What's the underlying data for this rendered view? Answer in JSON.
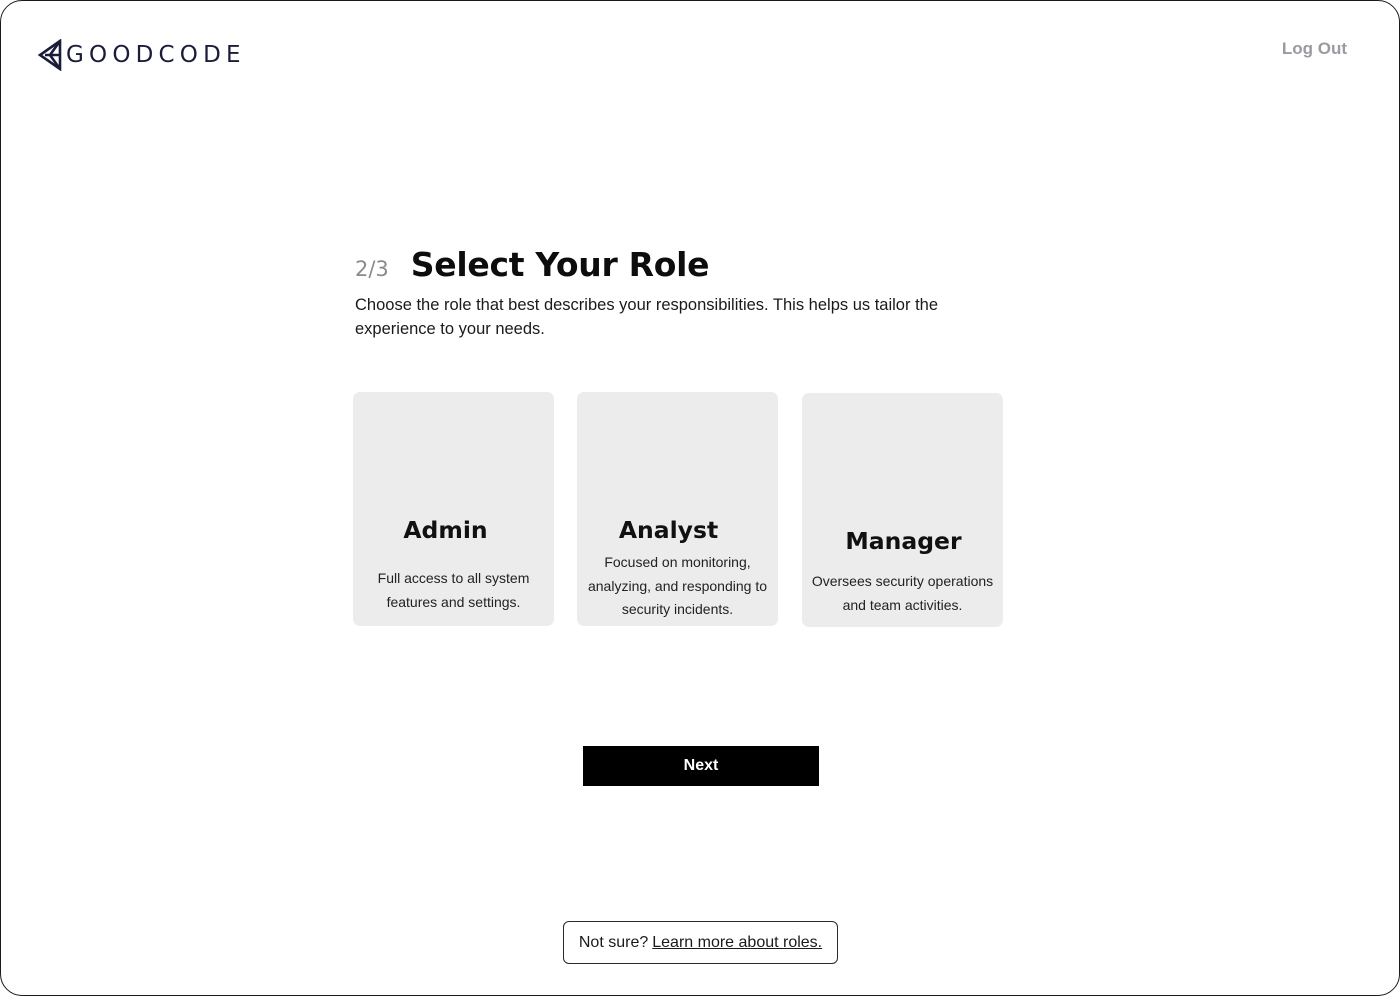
{
  "header": {
    "logo_text": "GOODCODE",
    "logout_label": "Log Out"
  },
  "main": {
    "step": "2/3",
    "title": "Select Your Role",
    "subtitle": "Choose the role that best describes your responsibilities. This helps us tailor the experience to your needs."
  },
  "roles": [
    {
      "name": "Admin",
      "description": "Full access to all system features and settings."
    },
    {
      "name": "Analyst",
      "description": "Focused on monitoring, analyzing, and responding to security incidents."
    },
    {
      "name": "Manager",
      "description": "Oversees security operations and team activities."
    }
  ],
  "actions": {
    "next_label": "Next"
  },
  "help": {
    "prefix": "Not sure?",
    "link_label": "Learn more about roles."
  },
  "colors": {
    "brand": "#1b1c3a",
    "card_bg": "#ececec",
    "primary_button": "#000000",
    "muted_text": "#9a9aa0"
  }
}
